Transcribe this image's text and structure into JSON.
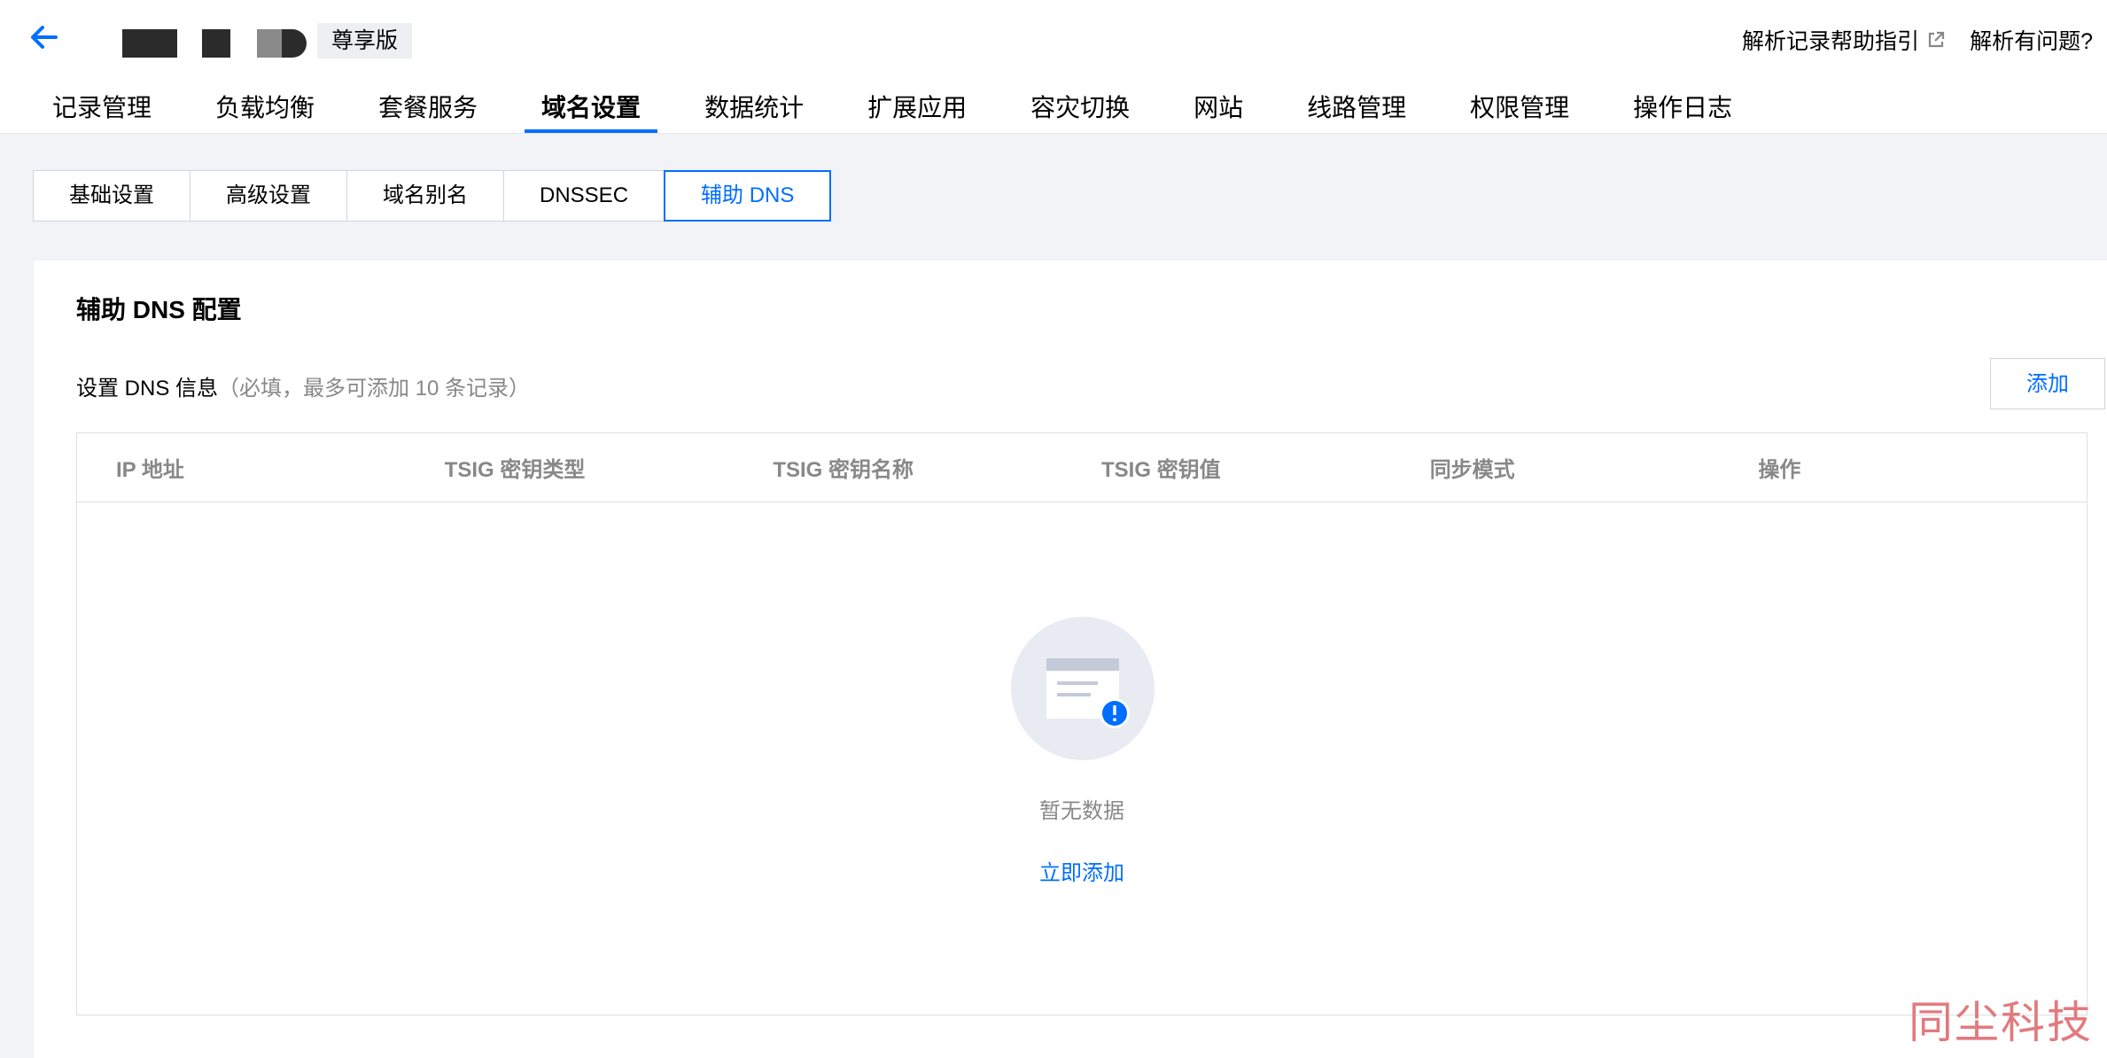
{
  "header": {
    "edition": "尊享版",
    "help_link": "解析记录帮助指引",
    "problem_link": "解析有问题?"
  },
  "main_nav": {
    "items": [
      {
        "label": "记录管理",
        "active": false
      },
      {
        "label": "负载均衡",
        "active": false
      },
      {
        "label": "套餐服务",
        "active": false
      },
      {
        "label": "域名设置",
        "active": true
      },
      {
        "label": "数据统计",
        "active": false
      },
      {
        "label": "扩展应用",
        "active": false
      },
      {
        "label": "容灾切换",
        "active": false
      },
      {
        "label": "网站",
        "active": false
      },
      {
        "label": "线路管理",
        "active": false
      },
      {
        "label": "权限管理",
        "active": false
      },
      {
        "label": "操作日志",
        "active": false
      }
    ]
  },
  "sub_tabs": {
    "items": [
      {
        "label": "基础设置",
        "active": false
      },
      {
        "label": "高级设置",
        "active": false
      },
      {
        "label": "域名别名",
        "active": false
      },
      {
        "label": "DNSSEC",
        "active": false
      },
      {
        "label": "辅助 DNS",
        "active": true
      }
    ]
  },
  "panel": {
    "title": "辅助 DNS 配置",
    "setting_label": "设置 DNS 信息",
    "setting_hint": "（必填，最多可添加 10 条记录）",
    "add_button": "添加",
    "table": {
      "columns": [
        "IP 地址",
        "TSIG 密钥类型",
        "TSIG 密钥名称",
        "TSIG 密钥值",
        "同步模式",
        "操作"
      ],
      "rows": []
    },
    "empty_text": "暂无数据",
    "add_now": "立即添加"
  },
  "watermark": "同尘科技",
  "colors": {
    "accent": "#006eff",
    "page_bg": "#f2f3f7",
    "muted_text": "#888888",
    "border": "#dcdfe6"
  },
  "icons": {
    "back": "arrow-left-icon",
    "external": "external-link-icon",
    "empty": "empty-doc-icon"
  }
}
